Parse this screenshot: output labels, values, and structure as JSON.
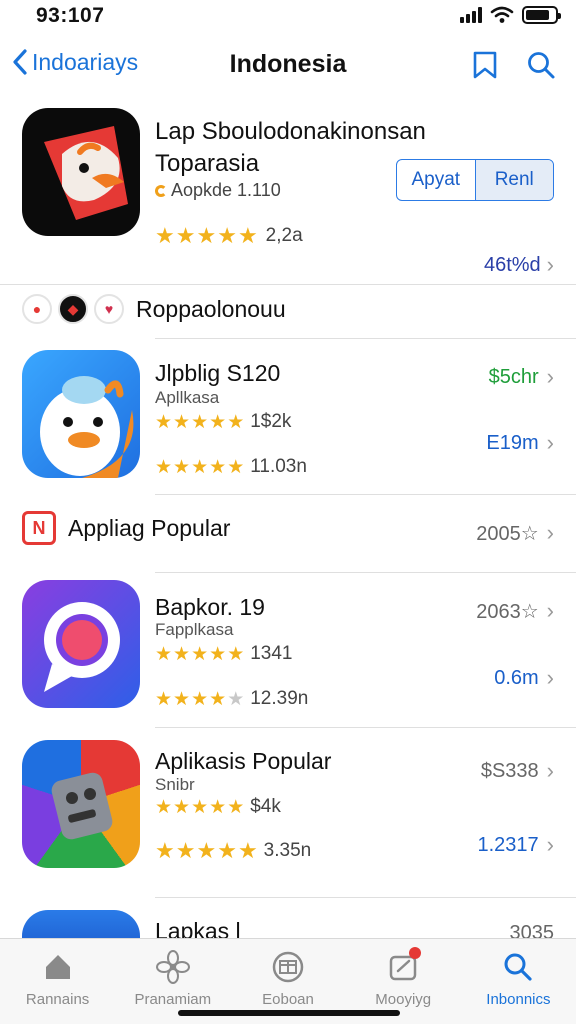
{
  "status": {
    "time": "93:107"
  },
  "nav": {
    "back_label": "Indoariays",
    "title": "Indonesia",
    "icons": [
      "bookmark-icon",
      "search-icon"
    ]
  },
  "featured": {
    "title_line1": "Lap Sboulodonakinonsan",
    "title_line2": "Toparasia",
    "subtitle": "Aopkde 1.110",
    "rating": 5,
    "rating_count": "2,2a",
    "btn_left": "Apyat",
    "btn_right": "Renl",
    "price": "46t%d"
  },
  "section1": {
    "title": "Roppaolonouu"
  },
  "app1": {
    "name": "Jlpblig S120",
    "sub": "Apllkasa",
    "rating1": 5,
    "count1": "1$2k",
    "rating2": 4.5,
    "count2": "11.03n",
    "price1": "$5chr",
    "price2": "E19m"
  },
  "section2": {
    "title": "Appliag Popular",
    "right": "2005☆"
  },
  "app2": {
    "name": "Bapkor. 19",
    "sub": "Fapplkasa",
    "rating1": 4.5,
    "count1": "1341",
    "rating2": 4,
    "count2": "12.39n",
    "price1": "2063☆",
    "price2": "0.6m"
  },
  "app3": {
    "name": "Aplikasis Popular",
    "sub": "Snibr",
    "rating1": 5,
    "count1": "$4k",
    "rating2": 5,
    "count2": "3.35n",
    "price1": "$S338",
    "price2": "1.2317"
  },
  "app4": {
    "name": "Lapkas l",
    "price1": "3035"
  },
  "tabs": [
    {
      "label": "Rannains",
      "icon": "home-icon"
    },
    {
      "label": "Pranamiam",
      "icon": "flower-icon"
    },
    {
      "label": "Eoboan",
      "icon": "calendar-icon"
    },
    {
      "label": "Mooyiyg",
      "icon": "notification-icon"
    },
    {
      "label": "Inbonnics",
      "icon": "search-icon"
    }
  ],
  "colors": {
    "accent": "#1a73d9",
    "star": "#f2b21c",
    "green": "#1f9e3a"
  }
}
